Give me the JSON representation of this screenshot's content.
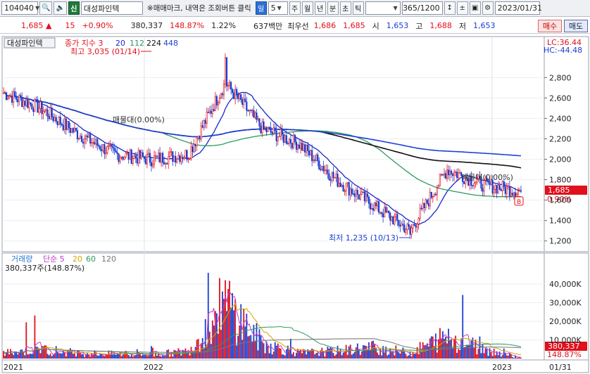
{
  "toolbar": {
    "code": "104040",
    "sin_label": "신",
    "stock_name": "대성파인텍",
    "memo": "※매매마크, 내역은 조회버튼 클릭",
    "period_day": "일",
    "period_num": "5",
    "periods": [
      "주",
      "월",
      "년",
      "분",
      "초",
      "틱"
    ],
    "count": "365/1200",
    "date": "2023/01/31"
  },
  "quote": {
    "price": "1,685",
    "change": "15",
    "change_pct": "+0.90%",
    "volume": "380,337",
    "volume_ratio": "148.87%",
    "turnover": "1.22%",
    "amount": "637백만",
    "best_label": "최우선",
    "ask": "1,686",
    "bid": "1,685",
    "open_label": "시",
    "open": "1,653",
    "high_label": "고",
    "high": "1,688",
    "low_label": "저",
    "low": "1,653",
    "buy_label": "매수",
    "sell_label": "매도"
  },
  "colors": {
    "up": "#e0101c",
    "down": "#1a3fd0",
    "ma3": "#1a28c8",
    "ma20": "#1a28c8",
    "ma112": "#2e9a5e",
    "ma224": "#111111",
    "ma448": "#1d3fd8"
  },
  "price_panel": {
    "title": "대성파인텍",
    "legend_label": "종가 지수 3",
    "ma": [
      "20",
      "112",
      "224",
      "448"
    ],
    "max_note": "최고 3,035 (01/14)",
    "min_note": "최저 1,235 (10/13)",
    "ma_label_1": "매물대(0.00%)",
    "ma_label_2": "매물대(0.00%)",
    "lc": "LC:36.44",
    "hc": "HC:-44.48",
    "last_price": "1,685",
    "last_pct": "0.90%",
    "mark_b": "B",
    "y_ticks": [
      "2,800",
      "2,600",
      "2,400",
      "2,200",
      "2,000",
      "1,800",
      "1,600",
      "1,400",
      "1,200"
    ]
  },
  "volume_panel": {
    "title": "거래량",
    "legend_label": "단순 5",
    "ma": [
      "20",
      "60",
      "120"
    ],
    "current": "380,337주(148.87%)",
    "last_volume": "380,337",
    "last_pct": "148.87%",
    "y_ticks": [
      "40,000K",
      "30,000K",
      "20,000K",
      "10,000K"
    ]
  },
  "x_axis": [
    "2021",
    "2022",
    "2023"
  ],
  "x_end": "01/31",
  "chart_data": {
    "type": "candlestick",
    "x": [
      "2021-01",
      "2021-03",
      "2021-05",
      "2021-07",
      "2021-09",
      "2021-11",
      "2022-01-14",
      "2022-03",
      "2022-05",
      "2022-07",
      "2022-09",
      "2022-10-13",
      "2022-11",
      "2022-12",
      "2023-01-31"
    ],
    "close": [
      2650,
      2500,
      2250,
      2050,
      2000,
      2050,
      2750,
      2300,
      2150,
      1800,
      1550,
      1300,
      1900,
      1750,
      1685
    ],
    "volume_k": [
      3000,
      5000,
      3000,
      2500,
      2000,
      4000,
      30000,
      8000,
      3000,
      4000,
      6000,
      3000,
      12000,
      5000,
      380
    ],
    "high": {
      "date": "2022-01-14",
      "value": 3035
    },
    "low": {
      "date": "2022-10-13",
      "value": 1235
    },
    "ylim": [
      1150,
      3050
    ],
    "volume_ylim": [
      0,
      46000
    ]
  }
}
